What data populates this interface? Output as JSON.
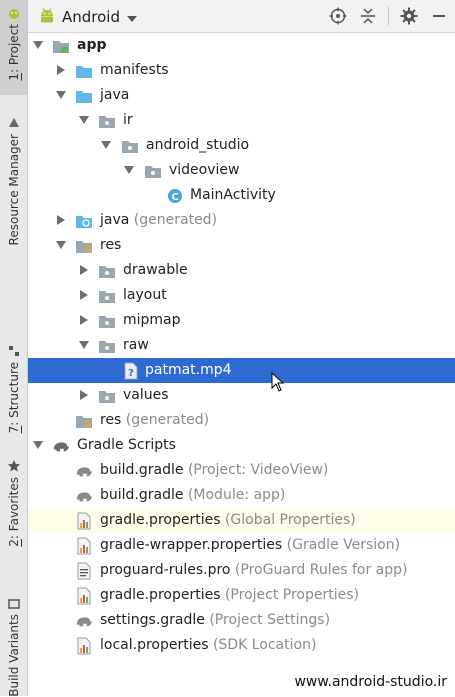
{
  "toolbar": {
    "view_selector": "Android",
    "icons": [
      "android-icon",
      "dropdown-icon",
      "locate-icon",
      "collapse-icon",
      "gear-icon",
      "minimize-icon"
    ]
  },
  "sidebar": {
    "tabs": [
      {
        "number": "1",
        "label": ": Project"
      },
      {
        "label": "Resource Manager"
      },
      {
        "number": "7",
        "label": ": Structure"
      },
      {
        "number": "2",
        "label": ": Favorites"
      },
      {
        "label": "Build Variants"
      }
    ]
  },
  "tree": [
    {
      "label": "app",
      "secondary": ""
    },
    {
      "label": "manifests",
      "secondary": ""
    },
    {
      "label": "java",
      "secondary": ""
    },
    {
      "label": "ir",
      "secondary": ""
    },
    {
      "label": "android_studio",
      "secondary": ""
    },
    {
      "label": "videoview",
      "secondary": ""
    },
    {
      "label": "MainActivity",
      "secondary": ""
    },
    {
      "label": "java",
      "secondary": " (generated)"
    },
    {
      "label": "res",
      "secondary": ""
    },
    {
      "label": "drawable",
      "secondary": ""
    },
    {
      "label": "layout",
      "secondary": ""
    },
    {
      "label": "mipmap",
      "secondary": ""
    },
    {
      "label": "raw",
      "secondary": ""
    },
    {
      "label": "patmat.mp4",
      "secondary": ""
    },
    {
      "label": "values",
      "secondary": ""
    },
    {
      "label": "res",
      "secondary": " (generated)"
    },
    {
      "label": "Gradle Scripts",
      "secondary": ""
    },
    {
      "label": "build.gradle",
      "secondary": " (Project: VideoView)"
    },
    {
      "label": "build.gradle",
      "secondary": " (Module: app)"
    },
    {
      "label": "gradle.properties",
      "secondary": " (Global Properties)"
    },
    {
      "label": "gradle-wrapper.properties",
      "secondary": " (Gradle Version)"
    },
    {
      "label": "proguard-rules.pro",
      "secondary": " (ProGuard Rules for app)"
    },
    {
      "label": "gradle.properties",
      "secondary": " (Project Properties)"
    },
    {
      "label": "settings.gradle",
      "secondary": " (Project Settings)"
    },
    {
      "label": "local.properties",
      "secondary": " (SDK Location)"
    }
  ],
  "selected_item": "patmat.mp4",
  "watermark": "www.android-studio.ir",
  "colors": {
    "selection": "#2d6ad1",
    "folder": "#9aa7b0",
    "folder_blue": "#62b7e6",
    "android_green": "#a4c639",
    "class_icon": "#4aa6d6"
  }
}
